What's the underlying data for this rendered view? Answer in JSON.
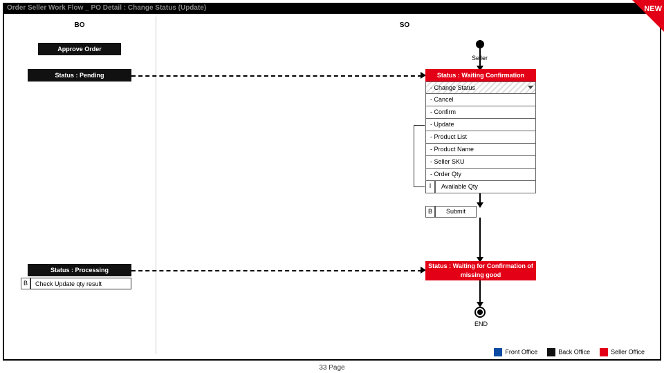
{
  "title": "Order Seller Work Flow _ PO Detail : Change Status (Update)",
  "newTag": "NEW",
  "columns": {
    "bo": "BO",
    "so": "SO"
  },
  "bo": {
    "approve": "Approve Order",
    "pending": "Status : Pending",
    "processing": "Status : Processing",
    "checkLabel": "Check Update qty result",
    "checkTag": "B"
  },
  "so": {
    "sellerLabel": "Seller",
    "status1": "Status : Waiting Confirmation",
    "rows": {
      "changeStatus": "- Change Status",
      "cancel": "   - Cancel",
      "confirm": "   - Confirm",
      "update": "   - Update",
      "productList": "- Product List",
      "productName": "   - Product Name",
      "sellerSku": "   - Seller SKU",
      "orderQty": "   - Order Qty",
      "availQty": "Available Qty",
      "availTag": "I"
    },
    "submit": "Submit",
    "submitTag": "B",
    "status2": "Status : Waiting for Confirmation of missing good",
    "end": "END"
  },
  "legend": {
    "front": "Front Office",
    "back": "Back Office",
    "seller": "Seller Office"
  },
  "footer": {
    "pageNum": "33",
    "pageWord": "Page"
  }
}
